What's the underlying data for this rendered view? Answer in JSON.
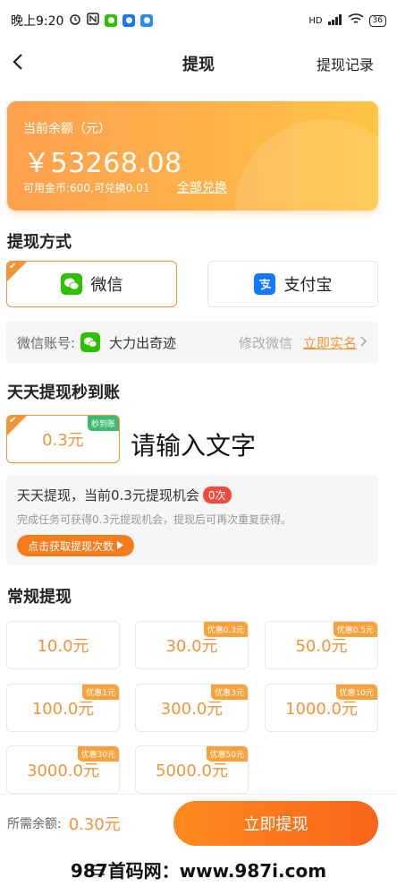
{
  "status_bar": {
    "time": "晚上9:20",
    "right_text": "HD",
    "battery": "36"
  },
  "nav": {
    "title": "提现",
    "right_label": "提现记录"
  },
  "balance": {
    "label": "当前余额（元）",
    "amount": "￥53268.08",
    "sub_text": "可用金币:600,可兑换0.01",
    "link_label": "全部兑换"
  },
  "method_section": {
    "title": "提现方式",
    "options": [
      {
        "label": "微信",
        "selected": true,
        "icon": "wechat-icon"
      },
      {
        "label": "支付宝",
        "selected": false,
        "icon": "alipay-icon"
      }
    ],
    "account": {
      "label": "微信账号:",
      "name": "大力出奇迹",
      "modify_label": "修改微信",
      "verify_label": "立即实名"
    }
  },
  "daily_section": {
    "title": "天天提现秒到账",
    "chip_amount": "0.3元",
    "chip_tag": "秒到账",
    "overlay_text": "请输入文字",
    "info": {
      "title": "天天提现，当前0.3元提现机会",
      "badge": "0次",
      "description": "完成任务可获得0.3元提现机会，提现后可再次重复获得。",
      "button_label": "点击获取提现次数"
    }
  },
  "regular_section": {
    "title": "常规提现",
    "amounts": [
      {
        "label": "10.0元",
        "tag": ""
      },
      {
        "label": "30.0元",
        "tag": "优惠0.3元"
      },
      {
        "label": "50.0元",
        "tag": "优惠0.5元"
      },
      {
        "label": "100.0元",
        "tag": "优惠1元"
      },
      {
        "label": "300.0元",
        "tag": "优惠3元"
      },
      {
        "label": "1000.0元",
        "tag": "优惠10元"
      },
      {
        "label": "3000.0元",
        "tag": "优惠30元"
      },
      {
        "label": "5000.0元",
        "tag": "优惠50元"
      }
    ]
  },
  "bottom_bar": {
    "label": "所需余额:",
    "value": "0.30元",
    "button_label": "立即提现"
  },
  "watermark": {
    "text": "987首码网：www.987i.com"
  },
  "colors": {
    "accent": "#f2943a",
    "button": "#f7641b",
    "wechat": "#2dc100",
    "alipay": "#1677ff",
    "badge_red": "#f04a3c"
  }
}
